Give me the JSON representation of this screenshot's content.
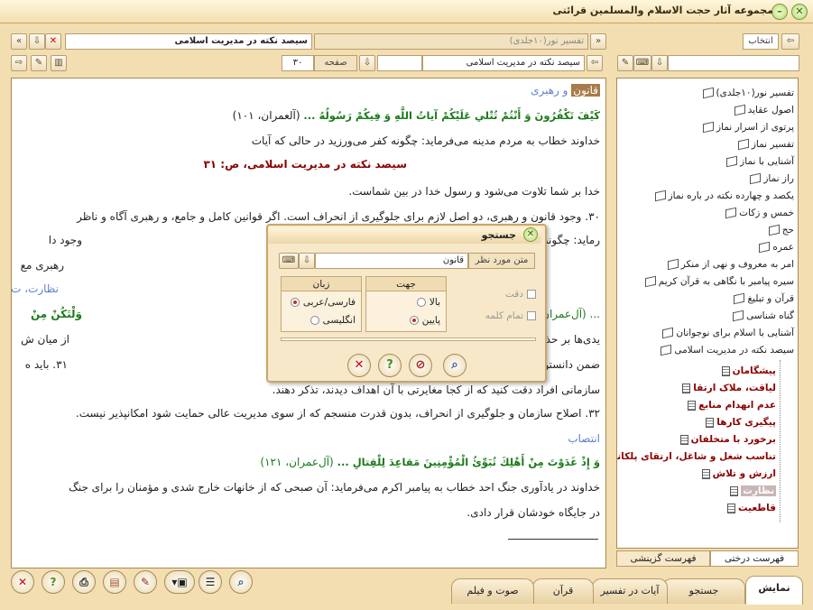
{
  "window": {
    "title": "مجموعه آثار حجت الاسلام والمسلمین قرائتی"
  },
  "viewer": {
    "tab_inactive": "تفسیر نور(۱۰جلدی)",
    "tab_active": "سیصد نکته در مدیریت اسلامی",
    "book_field": "سیصد نکته در مدیریت اسلامی",
    "page_label": "صفحه",
    "page_value": "۳۰"
  },
  "document": {
    "heading1_hl": "قانون",
    "heading1_rest": " و رهبری",
    "ayah1": "كَيْفَ تَكْفُرُونَ وَ أَنْتُمْ تُتْلي عَلَيْكُمْ آياتُ اللَّهِ وَ فِيكُمْ رَسُولُهُ ...",
    "ayah1_ref": "(آلعمران، ۱۰۱)",
    "line1": "خداوند خطاب به مردم مدینه می‌فرماید: چگونه کفر می‌ورزید در حالی که آیات",
    "book_title": "سیصد نکته در مدیریت اسلامی، ص: ۳۱",
    "line2": "خدا بر شما تلاوت می‌شود و رسول خدا در بین شماست.",
    "line3": "۳۰. وجود قانون و رهبری، دو اصل لازم برای جلوگیری از انحراف است. اگر قوانین کامل و جامع، و رهبری آگاه و ناظر",
    "line4a": "وجود دا",
    "line4b": "رماید: چگونه کافر می‌شوید در حالی که قوانین الهی و",
    "line5": "رهبری مع",
    "heading2": "نظارت، ت",
    "ayah2": "وَلْتَكُنْ مِنْ",
    "ayah2_ref": "... (آل‌عمران، ۱۰۴)",
    "line6a": "از میان ش",
    "line6b": "یدی‌ها بر حذر دارند.",
    "line7a": "۳۱. باید ه",
    "line7b": "ضمن دانستن اهداف سازمانی بر رفتارهای فردی و",
    "line8": "سازمانی افراد دقت کنید که از کجا مغایرتی با آن اهداف دیدند، تذکر دهند.",
    "line9": "۳۲. اصلاح سازمان و جلوگیری از انحراف، بدون قدرت منسجم که از سوی مدیریت عالی حمایت شود امکانپذیر نیست.",
    "heading3": "انتصاب",
    "ayah3": "وَ إِذْ غَدَوْتَ مِنْ أَهْلِكَ تُبَوِّئُ الْمُؤْمِنِينَ مَقاعِدَ لِلْقِتالِ ...",
    "ayah3_ref": "(آل‌عمران، ۱۲۱)",
    "line10": "خداوند در یادآوری جنگ احد خطاب به پیامبر اکرم می‌فرماید: آن صبحی که از خانهات خارج شدی و مؤمنان را برای جنگ",
    "line11": "در جایگاه خودشان قرار دادی."
  },
  "search_dialog": {
    "title": "جستجو",
    "field_label": "متن مورد نظر",
    "field_value": "قانون",
    "direction_header": "جهت",
    "dir_up": "بالا",
    "dir_down": "پایین",
    "language_header": "زبان",
    "lang_fa": "فارسی/عربی",
    "lang_en": "انگلیسی",
    "accuracy": "دقت",
    "whole_word": "تمام کلمه"
  },
  "right_panel": {
    "select_button": "انتخاب",
    "tree": [
      "تفسیر نور(۱۰جلدی)",
      "اصول عقاید",
      "پرتوی از اسرار نماز",
      "تفسیر نماز",
      "آشنایی با نماز",
      "راز نماز",
      "یکصد و چهارده نکته در باره نماز",
      "خمس و زکات",
      "حج",
      "عمره",
      "امر به معروف و نهی از منکر",
      "سیره پیامبر با نگاهی به قرآن کریم",
      "قرآن و تبلیغ",
      "گناه شناسی",
      "آشنایی با اسلام برای نوجوانان",
      "سیصد نکته در مدیریت اسلامی"
    ],
    "subtree": [
      "پیشگامان",
      "لیاقت، ملاک ارتقا",
      "عدم انهدام منابع",
      "پیگیری کارها",
      "برخورد با متخلفان",
      "تناسب شغل و شاغل، ارتقای پلکانی",
      "ارزش و تلاش",
      "نظارت",
      "قاطعیت"
    ],
    "tab_tree": "فهرست درختی",
    "tab_selective": "فهرست گزینشی"
  },
  "bottom_tabs": [
    "نمایش",
    "جستجو",
    "آیات در تفسیر",
    "قرآن",
    "صوت و فیلم"
  ]
}
